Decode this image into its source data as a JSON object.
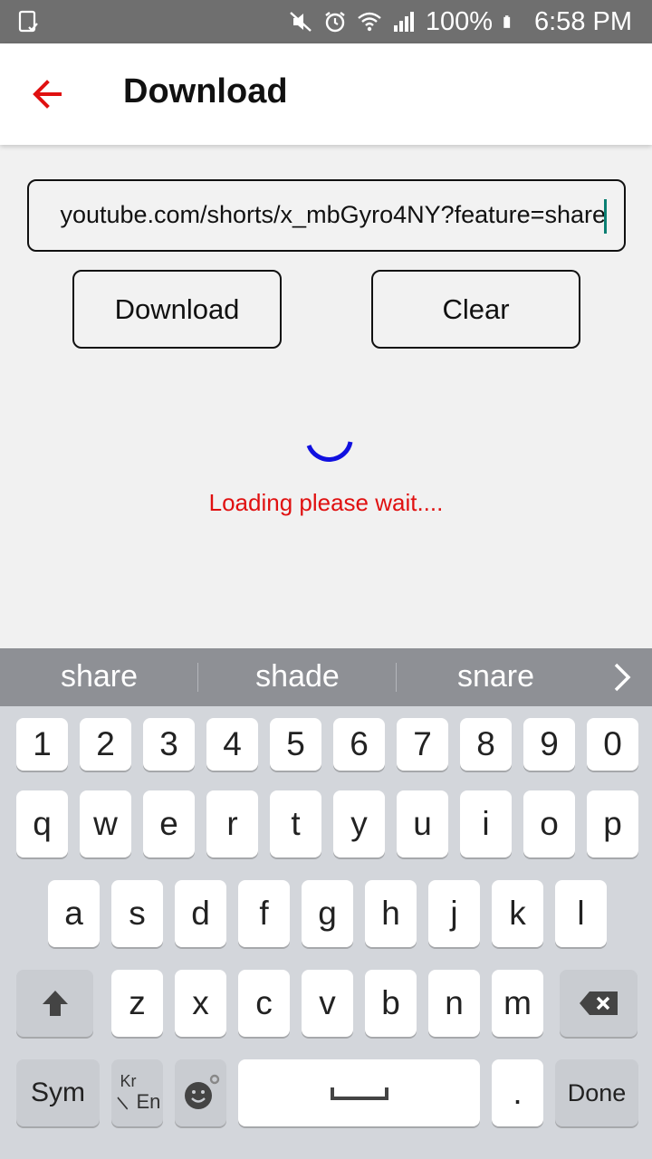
{
  "status_bar": {
    "battery": "100%",
    "time": "6:58 PM",
    "icons": [
      "screenshot-icon",
      "mute-icon",
      "alarm-icon",
      "wifi-icon",
      "signal-icon",
      "battery-icon"
    ]
  },
  "app_bar": {
    "title": "Download",
    "back_icon": "arrow-left-icon",
    "accent_color": "#e01010"
  },
  "form": {
    "url_value": "youtube.com/shorts/x_mbGyro4NY?feature=share",
    "download_label": "Download",
    "clear_label": "Clear"
  },
  "loading": {
    "text": "Loading please wait....",
    "spinner_color": "#1010e0"
  },
  "keyboard": {
    "suggestions": [
      "share",
      "shade",
      "snare"
    ],
    "row_numbers": [
      "1",
      "2",
      "3",
      "4",
      "5",
      "6",
      "7",
      "8",
      "9",
      "0"
    ],
    "row_top": [
      "q",
      "w",
      "e",
      "r",
      "t",
      "y",
      "u",
      "i",
      "o",
      "p"
    ],
    "row_middle": [
      "a",
      "s",
      "d",
      "f",
      "g",
      "h",
      "j",
      "k",
      "l"
    ],
    "row_bottom": [
      "z",
      "x",
      "c",
      "v",
      "b",
      "n",
      "m"
    ],
    "sym_label": "Sym",
    "lang_top": "Kr",
    "lang_bottom": "En",
    "period_label": ".",
    "done_label": "Done"
  }
}
